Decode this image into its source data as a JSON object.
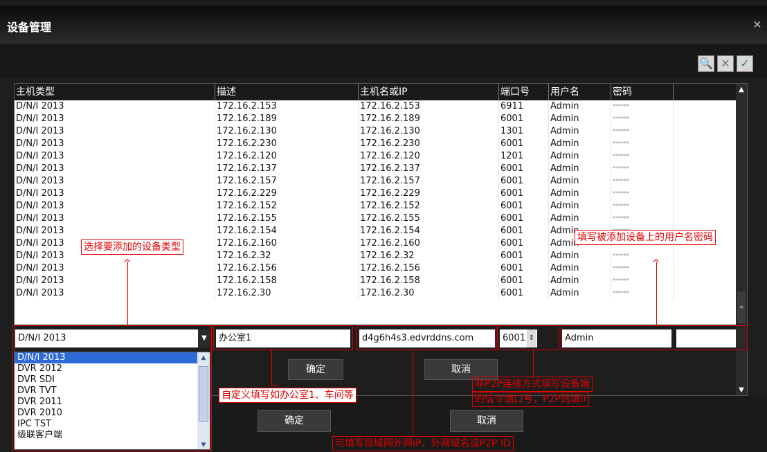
{
  "window": {
    "title": "设备管理",
    "close_icon": "close-icon"
  },
  "toolbar": {
    "search_icon": "search-icon",
    "delete_icon": "delete-icon",
    "confirm_icon": "checkmark-icon"
  },
  "table": {
    "headers": [
      "主机类型",
      "描述",
      "主机名或IP",
      "端口号",
      "用户名",
      "密码"
    ],
    "rows": [
      [
        "D/N/I 2013",
        "172.16.2.153",
        "172.16.2.153",
        "6911",
        "Admin",
        "******"
      ],
      [
        "D/N/I 2013",
        "172.16.2.189",
        "172.16.2.189",
        "6001",
        "Admin",
        "******"
      ],
      [
        "D/N/I 2013",
        "172.16.2.130",
        "172.16.2.130",
        "1301",
        "Admin",
        "******"
      ],
      [
        "D/N/I 2013",
        "172.16.2.230",
        "172.16.2.230",
        "6001",
        "Admin",
        "******"
      ],
      [
        "D/N/I 2013",
        "172.16.2.120",
        "172.16.2.120",
        "1201",
        "Admin",
        "******"
      ],
      [
        "D/N/I 2013",
        "172.16.2.137",
        "172.16.2.137",
        "6001",
        "Admin",
        "******"
      ],
      [
        "D/N/I 2013",
        "172.16.2.157",
        "172.16.2.157",
        "6001",
        "Admin",
        "******"
      ],
      [
        "D/N/I 2013",
        "172.16.2.229",
        "172.16.2.229",
        "6001",
        "Admin",
        "******"
      ],
      [
        "D/N/I 2013",
        "172.16.2.152",
        "172.16.2.152",
        "6001",
        "Admin",
        "******"
      ],
      [
        "D/N/I 2013",
        "172.16.2.155",
        "172.16.2.155",
        "6001",
        "Admin",
        "******"
      ],
      [
        "D/N/I 2013",
        "172.16.2.154",
        "172.16.2.154",
        "6001",
        "Admin",
        "******"
      ],
      [
        "D/N/I 2013",
        "172.16.2.160",
        "172.16.2.160",
        "6001",
        "Admin",
        "******"
      ],
      [
        "D/N/I 2013",
        "172.16.2.32",
        "172.16.2.32",
        "6001",
        "Admin",
        "******"
      ],
      [
        "D/N/I 2013",
        "172.16.2.156",
        "172.16.2.156",
        "6001",
        "Admin",
        "******"
      ],
      [
        "D/N/I 2013",
        "172.16.2.158",
        "172.16.2.158",
        "6001",
        "Admin",
        "******"
      ],
      [
        "D/N/I 2013",
        "172.16.2.30",
        "172.16.2.30",
        "6001",
        "Admin",
        "******"
      ]
    ]
  },
  "edit": {
    "type_value": "D/N/I 2013",
    "desc_value": "办公室1",
    "host_value": "d4g6h4s3.edvrddns.com",
    "port_value": "6001",
    "user_value": "Admin",
    "password_value": ""
  },
  "dropdown_options": [
    "D/N/I 2013",
    "DVR 2012",
    "DVR SDI",
    "DVR TVT",
    "DVR 2011",
    "DVR 2010",
    "IPC TST",
    "级联客户端"
  ],
  "buttons": {
    "inner_ok": "确定",
    "inner_cancel": "取消",
    "outer_ok": "确定",
    "outer_cancel": "取消"
  },
  "annotations": {
    "select_type": "选择要添加的设备类型",
    "fill_user": "填写被添加设备上的用户名密码",
    "custom_desc": "自定义填写如办公室1、车间等",
    "port_hint_line1": "非P2P连接方式填写设备端",
    "port_hint_line2": "的信令端口号，P2P则填0",
    "host_hint": "可填写局域网外网IP、外网域名或P2P ID"
  }
}
